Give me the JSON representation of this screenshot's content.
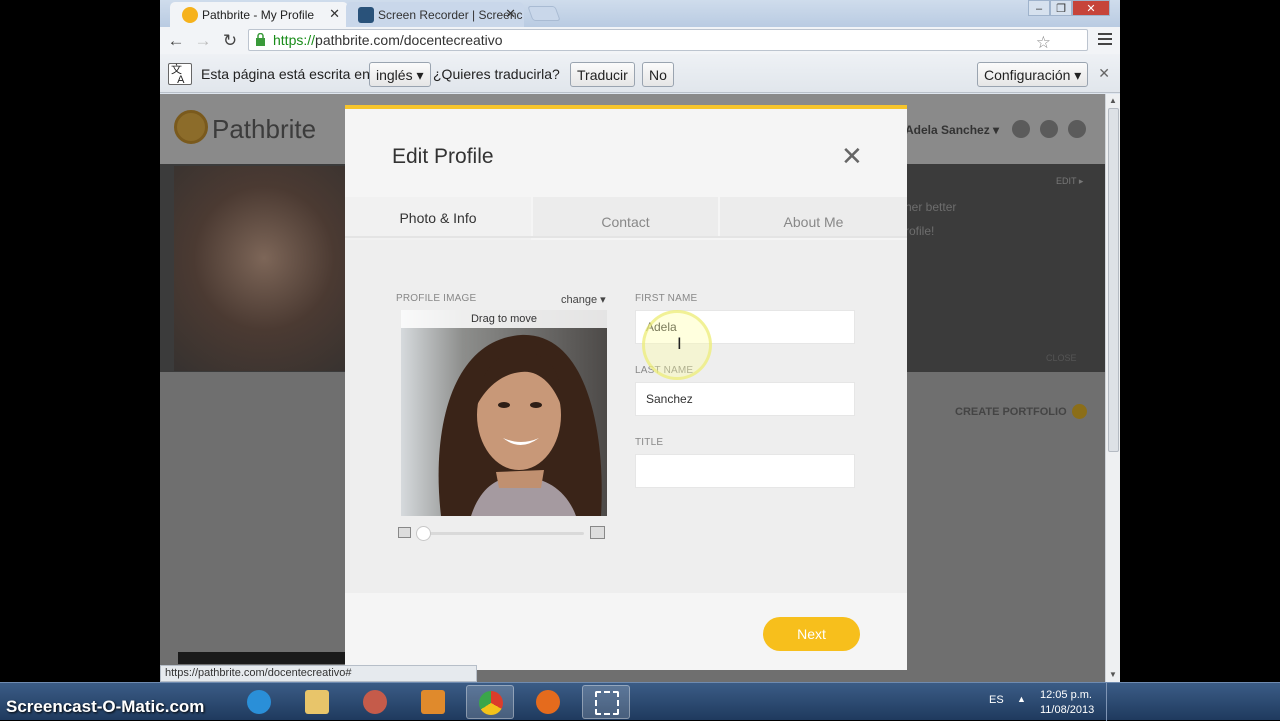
{
  "browser": {
    "tabs": [
      {
        "title": "Pathbrite - My Profile",
        "active": true
      },
      {
        "title": "Screen Recorder | Screenc",
        "active": false
      }
    ],
    "url_scheme": "https://",
    "url_rest": "pathbrite.com/docentecreativo"
  },
  "translate_bar": {
    "text_before": "Esta página está escrita en",
    "language": "inglés",
    "question": "¿Quieres traducirla?",
    "translate_button": "Traducir",
    "no_button": "No",
    "settings_button": "Configuración"
  },
  "page": {
    "logo_text": "Pathbrite",
    "user_name": "Adela Sanchez",
    "banner_text_1": "her better",
    "banner_text_2": "rofile!",
    "edit_link": "EDIT",
    "close_link": "CLOSE",
    "create_portfolio": "CREATE PORTFOLIO"
  },
  "modal": {
    "title": "Edit Profile",
    "tabs": [
      "Photo & Info",
      "Contact",
      "About Me"
    ],
    "profile_image_label": "PROFILE IMAGE",
    "change_link": "change",
    "drag_hint": "Drag to move",
    "first_name_label": "FIRST NAME",
    "first_name_value": "Adela",
    "last_name_label": "LAST NAME",
    "last_name_value": "Sanchez",
    "title_label": "TITLE",
    "title_value": "",
    "next_button": "Next"
  },
  "status_bar": {
    "url": "https://pathbrite.com/docentecreativo#"
  },
  "taskbar": {
    "watermark": "Screencast-O-Matic.com",
    "language": "ES",
    "time": "12:05 p.m.",
    "date": "11/08/2013"
  },
  "colors": {
    "accent_yellow": "#f6c52c",
    "next_button": "#f7bf1c",
    "https_green": "#188c18"
  },
  "icons": [
    "pathbrite-favicon",
    "screencast-favicon",
    "back-icon",
    "forward-icon",
    "reload-icon",
    "lock-icon",
    "star-icon",
    "menu-icon",
    "translate-icon",
    "close-icon",
    "zoom-small-icon",
    "zoom-large-icon",
    "start-orb-icon",
    "ie-icon",
    "folder-icon",
    "chrome-icon",
    "firefox-icon"
  ]
}
